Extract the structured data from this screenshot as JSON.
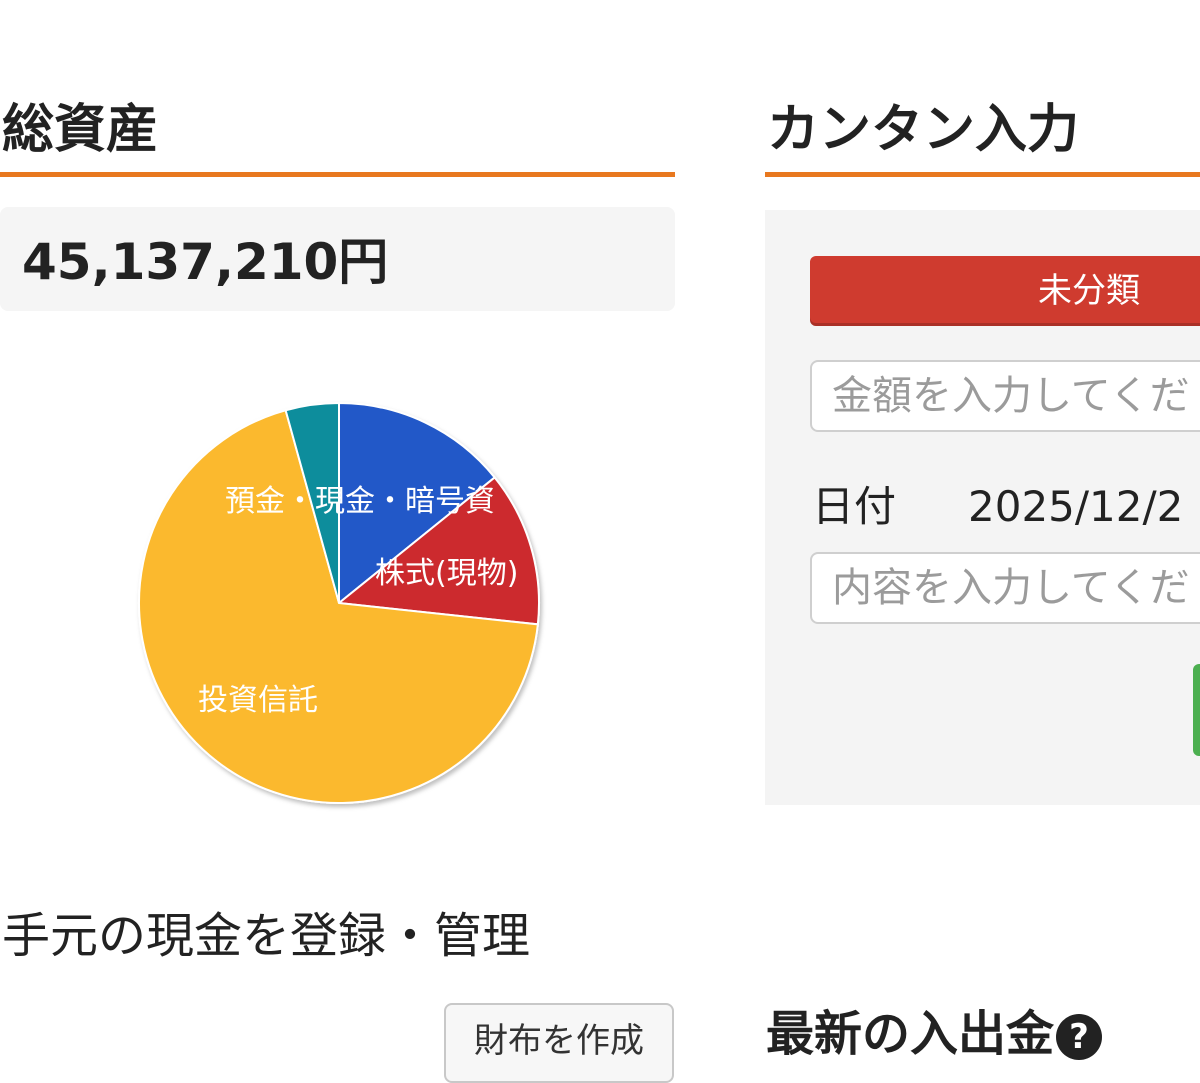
{
  "assets": {
    "title": "総資産",
    "total": "45,137,210円"
  },
  "chart_data": {
    "type": "pie",
    "slices": [
      {
        "label": "預金・現金・暗号資産",
        "visible_label": "預金・現金・暗号資",
        "percent": 14.2,
        "color": "#2058c8"
      },
      {
        "label": "株式(現物)",
        "visible_label": "株式(現物)",
        "percent": 12.5,
        "color": "#cc2a2f"
      },
      {
        "label": "投資信託",
        "visible_label": "投資信託",
        "percent": 69.0,
        "color": "#fbb92e"
      },
      {
        "label": "",
        "visible_label": "",
        "percent": 4.3,
        "color": "#0a8d9c"
      }
    ]
  },
  "cash": {
    "heading": "手元の現金を登録・管理",
    "wallet_button": "財布を作成"
  },
  "quick_input": {
    "title": "カンタン入力",
    "category_button": "未分類",
    "amount_placeholder": "金額を入力してくだ",
    "date_label": "日付",
    "date_value": "2025/12/2",
    "content_placeholder": "内容を入力してくだ"
  },
  "latest": {
    "heading": "最新の入出金",
    "help_icon_glyph": "?"
  }
}
